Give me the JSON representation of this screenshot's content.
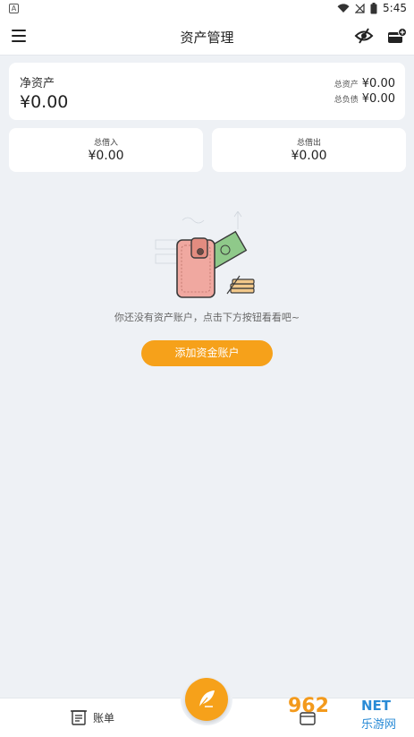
{
  "status": {
    "left_icon": "a-icon",
    "left_letter": "A",
    "time": "5:45"
  },
  "appbar": {
    "title": "资产管理",
    "menu_icon": "menu-icon",
    "eye_icon": "eye-off-icon",
    "wallet_icon": "wallet-add-icon"
  },
  "net_assets": {
    "label": "净资产",
    "value": "¥0.00"
  },
  "totals": {
    "assets_label": "总资产",
    "assets_value": "¥0.00",
    "liabilities_label": "总负债",
    "liabilities_value": "¥0.00"
  },
  "borrow_in": {
    "label": "总借入",
    "value": "¥0.00"
  },
  "borrow_out": {
    "label": "总借出",
    "value": "¥0.00"
  },
  "empty_state": {
    "illustration": "empty-wallet-illustration",
    "message": "你还没有资产账户，点击下方按钮看看吧~"
  },
  "add_button": {
    "label": "添加资金账户"
  },
  "bottom_nav": {
    "bills_label": "账单",
    "fab_icon": "quill-icon"
  },
  "watermark": {
    "number": "962",
    "domain": "NET",
    "site": "乐游网"
  },
  "colors": {
    "accent": "#f6a11a",
    "background": "#eef1f5",
    "card": "#ffffff"
  }
}
